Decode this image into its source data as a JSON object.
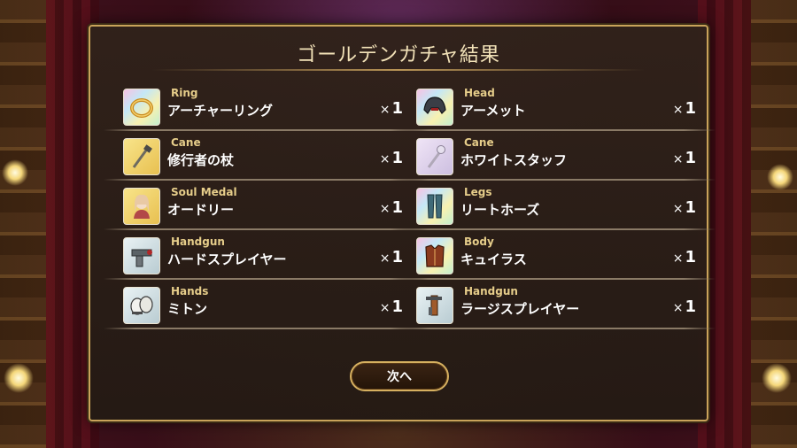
{
  "dialog": {
    "title": "ゴールデンガチャ結果",
    "next_label": "次へ"
  },
  "qty_prefix": "×",
  "results": [
    {
      "category": "Ring",
      "name": "アーチャーリング",
      "qty": "1",
      "icon": "ring-icon",
      "frame": "rainbow"
    },
    {
      "category": "Head",
      "name": "アーメット",
      "qty": "1",
      "icon": "helmet-icon",
      "frame": "rainbow"
    },
    {
      "category": "Cane",
      "name": "修行者の杖",
      "qty": "1",
      "icon": "staff-icon",
      "frame": "gold"
    },
    {
      "category": "Cane",
      "name": "ホワイトスタッフ",
      "qty": "1",
      "icon": "white-staff-icon",
      "frame": "lav"
    },
    {
      "category": "Soul Medal",
      "name": "オードリー",
      "qty": "1",
      "icon": "character-portrait-icon",
      "frame": "gold"
    },
    {
      "category": "Legs",
      "name": "リートホーズ",
      "qty": "1",
      "icon": "leg-armor-icon",
      "frame": "rainbow"
    },
    {
      "category": "Handgun",
      "name": "ハードスプレイヤー",
      "qty": "1",
      "icon": "handgun-icon",
      "frame": "silver"
    },
    {
      "category": "Body",
      "name": "キュイラス",
      "qty": "1",
      "icon": "body-armor-icon",
      "frame": "rainbow"
    },
    {
      "category": "Hands",
      "name": "ミトン",
      "qty": "1",
      "icon": "gloves-icon",
      "frame": "silver"
    },
    {
      "category": "Handgun",
      "name": "ラージスプレイヤー",
      "qty": "1",
      "icon": "large-gun-icon",
      "frame": "silver"
    }
  ]
}
